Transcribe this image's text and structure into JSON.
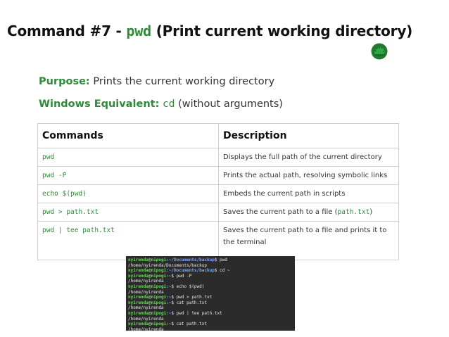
{
  "title": {
    "prefix": "Command #7 - ",
    "command": "pwd",
    "suffix": " (Print current working directory)"
  },
  "purpose": {
    "label": "Purpose:",
    "text": "Prints the current working directory"
  },
  "windows_equivalent": {
    "label": "Windows Equivalent:",
    "command": "cd",
    "text": "(without arguments)"
  },
  "table": {
    "headers": [
      "Commands",
      "Description"
    ],
    "rows": [
      {
        "command": "pwd",
        "description": "Displays the full path of the current directory"
      },
      {
        "command": "pwd -P",
        "description": "Prints the actual path, resolving symbolic links"
      },
      {
        "command": "echo $(pwd)",
        "description": "Embeds the current path in scripts"
      },
      {
        "command": "pwd > path.txt",
        "description_before": "Saves the current path to a file (",
        "description_code": "path.txt",
        "description_after": ")"
      },
      {
        "command": "pwd | tee path.txt",
        "description": "Saves the current path to a file and prints it to the terminal"
      }
    ]
  },
  "terminal": {
    "lines": [
      {
        "user": "nyirenda@nipogi",
        "path": ":~/Documents/backup",
        "cmd": "$ pwd"
      },
      {
        "out": "/home/nyirenda/Documents/backup"
      },
      {
        "user": "nyirenda@nipogi",
        "path": ":~/Documents/backup",
        "cmd": "$ cd ~"
      },
      {
        "user": "nyirenda@nipogi",
        "path": ":~",
        "cmd": "$ pwd -P"
      },
      {
        "out": "/home/nyirenda"
      },
      {
        "user": "nyirenda@nipogi",
        "path": ":~",
        "cmd": "$ echo $(pwd)"
      },
      {
        "out": "/home/nyirenda"
      },
      {
        "user": "nyirenda@nipogi",
        "path": ":~",
        "cmd": "$ pwd > path.txt"
      },
      {
        "user": "nyirenda@nipogi",
        "path": ":~",
        "cmd": "$ cat path.txt"
      },
      {
        "out": "/home/nyirenda"
      },
      {
        "user": "nyirenda@nipogi",
        "path": ":~",
        "cmd": "$ pwd | tee path.txt"
      },
      {
        "out": "/home/nyirenda"
      },
      {
        "user": "nyirenda@nipogi",
        "path": ":~",
        "cmd": "$ cat path.txt"
      },
      {
        "out": "/home/nyirenda"
      }
    ]
  },
  "colors": {
    "accent_green": "#2e8b3a",
    "terminal_bg": "#2b2b2b",
    "prompt_user": "#6ad85a",
    "prompt_path": "#7aa7ff"
  },
  "logo_icon": "hedgehog-logo-icon"
}
